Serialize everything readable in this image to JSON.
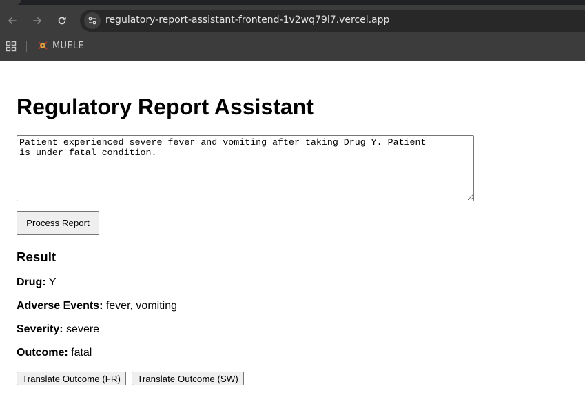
{
  "browser": {
    "url": "regulatory-report-assistant-frontend-1v2wq79l7.vercel.app",
    "bookmark_label": "MUELE"
  },
  "page": {
    "title": "Regulatory Report Assistant",
    "report_text": "Patient experienced severe fever and vomiting after taking Drug Y. Patient\nis under fatal condition.",
    "process_button": "Process Report",
    "result_heading": "Result",
    "fields": {
      "drug_label": "Drug:",
      "drug_value": " Y",
      "adverse_label": "Adverse Events:",
      "adverse_value": " fever, vomiting",
      "severity_label": "Severity:",
      "severity_value": " severe",
      "outcome_label": "Outcome:",
      "outcome_value": " fatal"
    },
    "translate_fr": "Translate Outcome (FR)",
    "translate_sw": "Translate Outcome (SW)"
  }
}
